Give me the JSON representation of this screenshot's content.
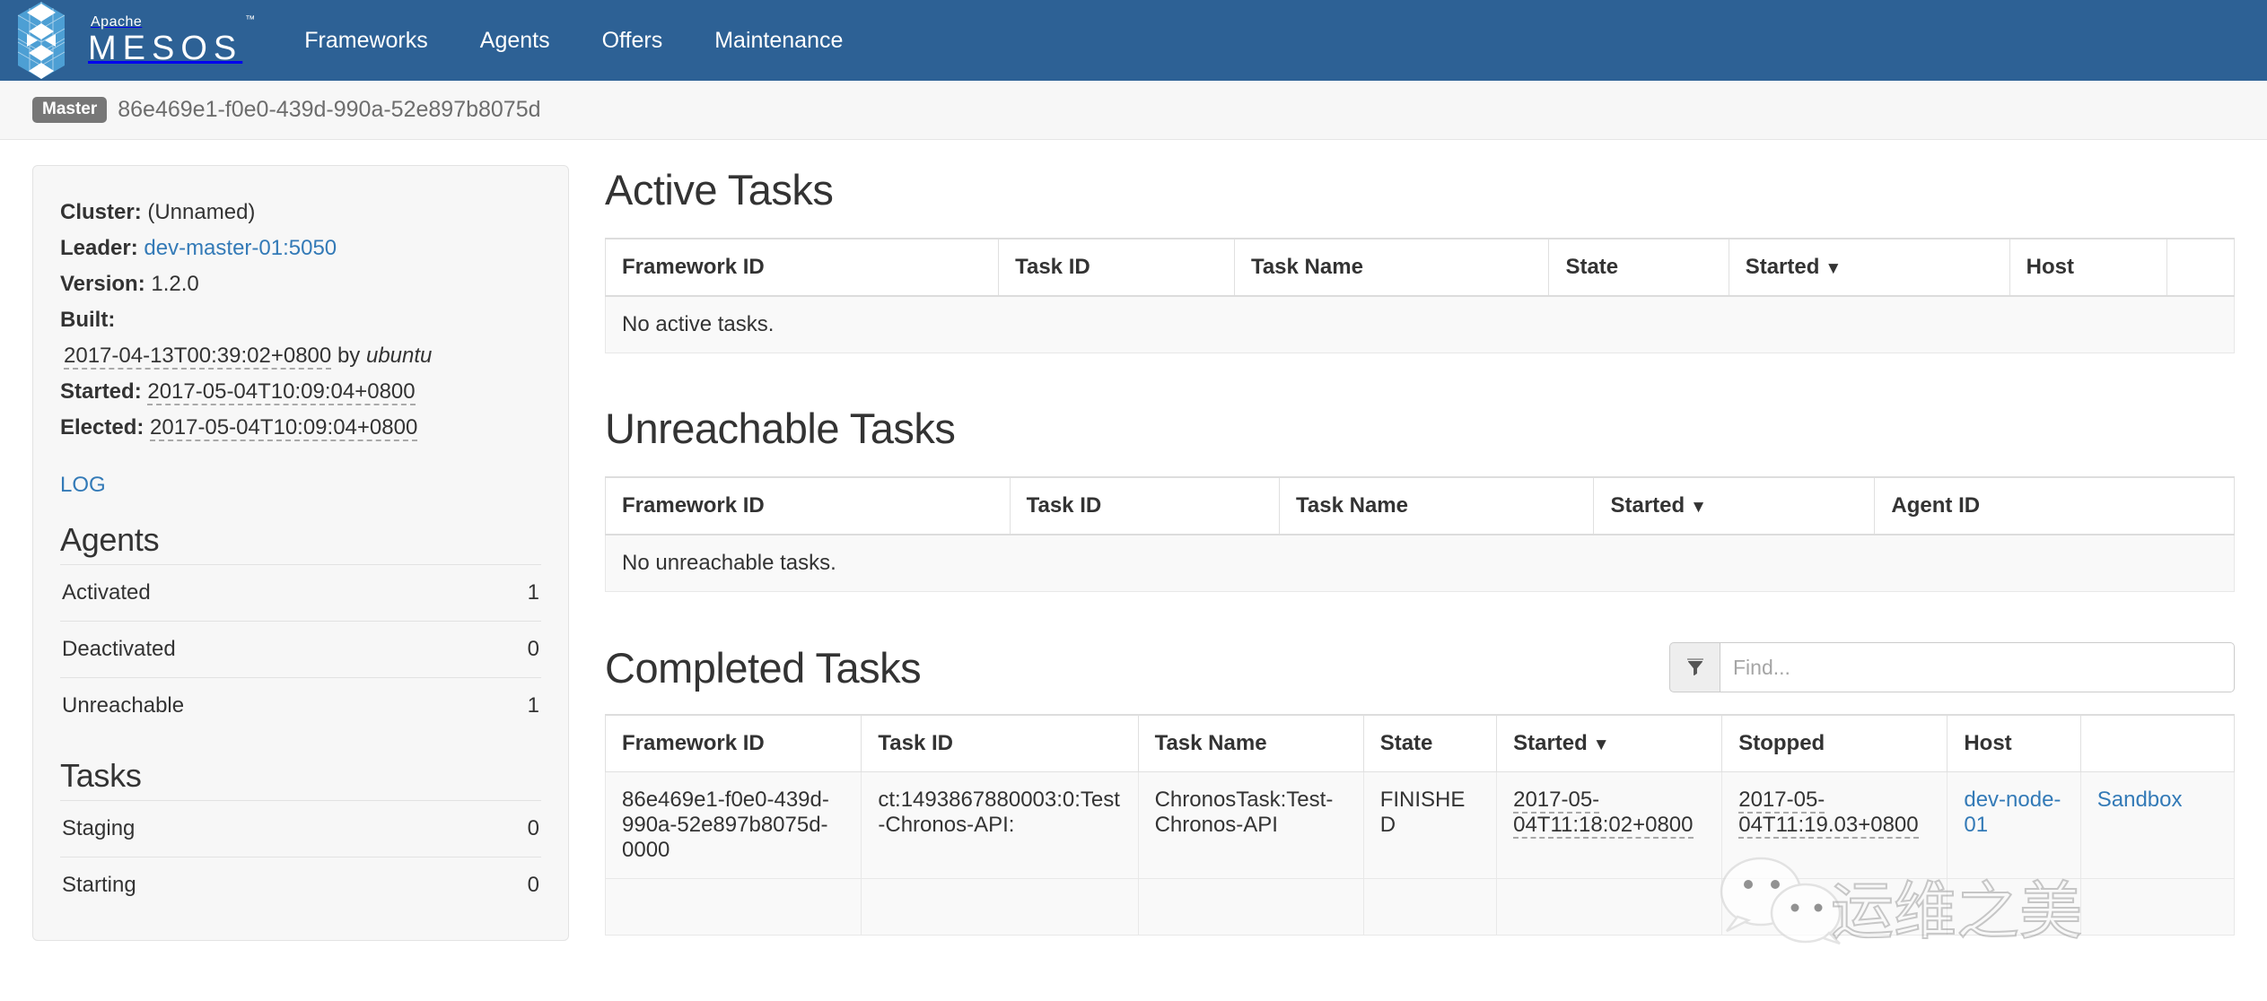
{
  "navbar": {
    "brand": {
      "apache": "Apache",
      "mesos": "MESOS",
      "tm": "™",
      "icon": "mesos-logo-icon"
    },
    "links": [
      {
        "label": "Frameworks",
        "name": "nav-link-frameworks"
      },
      {
        "label": "Agents",
        "name": "nav-link-agents"
      },
      {
        "label": "Offers",
        "name": "nav-link-offers"
      },
      {
        "label": "Maintenance",
        "name": "nav-link-maintenance"
      }
    ]
  },
  "masterbar": {
    "badge": "Master",
    "id": "86e469e1-f0e0-439d-990a-52e897b8075d"
  },
  "sidebar": {
    "cluster_label": "Cluster:",
    "cluster_value": "(Unnamed)",
    "leader_label": "Leader:",
    "leader_value": "dev-master-01:5050",
    "version_label": "Version:",
    "version_value": "1.2.0",
    "built_label": "Built:",
    "built_value": "2017-04-13T00:39:02+0800",
    "built_by": "by",
    "built_user": "ubuntu",
    "started_label": "Started:",
    "started_value": "2017-05-04T10:09:04+0800",
    "elected_label": "Elected:",
    "elected_value": "2017-05-04T10:09:04+0800",
    "log_link": "LOG",
    "agents_title": "Agents",
    "agents_rows": [
      {
        "label": "Activated",
        "value": "1"
      },
      {
        "label": "Deactivated",
        "value": "0"
      },
      {
        "label": "Unreachable",
        "value": "1"
      }
    ],
    "tasks_title": "Tasks",
    "tasks_rows": [
      {
        "label": "Staging",
        "value": "0"
      },
      {
        "label": "Starting",
        "value": "0"
      }
    ]
  },
  "active_tasks": {
    "title": "Active Tasks",
    "columns": [
      "Framework ID",
      "Task ID",
      "Task Name",
      "State",
      "Started",
      "Host",
      ""
    ],
    "sort_column": "Started",
    "sort_caret": "▼",
    "empty_message": "No active tasks.",
    "rows": []
  },
  "unreachable_tasks": {
    "title": "Unreachable Tasks",
    "columns": [
      "Framework ID",
      "Task ID",
      "Task Name",
      "Started",
      "Agent ID"
    ],
    "sort_column": "Started",
    "sort_caret": "▼",
    "empty_message": "No unreachable tasks.",
    "rows": []
  },
  "completed_tasks": {
    "title": "Completed Tasks",
    "filter": {
      "icon": "funnel-icon",
      "placeholder": "Find...",
      "value": ""
    },
    "columns": [
      "Framework ID",
      "Task ID",
      "Task Name",
      "State",
      "Started",
      "Stopped",
      "Host",
      ""
    ],
    "sort_column": "Started",
    "sort_caret": "▼",
    "rows": [
      {
        "framework_id": "86e469e1-f0e0-439d-990a-52e897b8075d-0000",
        "task_id": "ct:1493867880003:0:Test-Chronos-API:",
        "task_name": "ChronosTask:Test-Chronos-API",
        "state": "FINISHED",
        "started": "2017-05-04T11:18:02+0800",
        "stopped": "2017-05-04T11:19.03+0800",
        "host": "dev-node-01",
        "sandbox": "Sandbox"
      }
    ]
  },
  "watermark": {
    "text": "运维之美",
    "icon": "wechat-icon"
  },
  "colors": {
    "navbar": "#2d6195",
    "link": "#337ab7",
    "badge": "#777777",
    "panel": "#f7f7f7"
  }
}
